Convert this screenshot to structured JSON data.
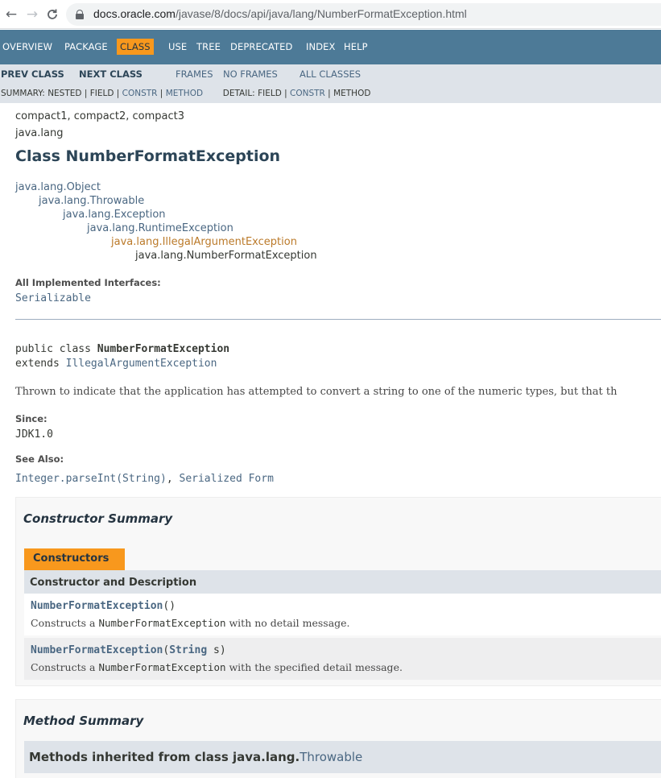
{
  "browser": {
    "back_icon": "←",
    "forward_icon": "→",
    "reload_icon": "C",
    "url_host": "docs.oracle.com",
    "url_path": "/javase/8/docs/api/java/lang/NumberFormatException.html"
  },
  "topnav": {
    "items": [
      "OVERVIEW",
      "PACKAGE",
      "CLASS",
      "USE",
      "TREE",
      "DEPRECATED",
      "INDEX",
      "HELP"
    ],
    "active": "CLASS",
    "active_color": "#f8981d",
    "bar_color": "#4d7a97"
  },
  "subnav": {
    "prev_class": "PREV CLASS",
    "next_class": "NEXT CLASS",
    "frames": "FRAMES",
    "no_frames": "NO FRAMES",
    "all_classes": "ALL CLASSES",
    "summary_label": "SUMMARY:",
    "summary_nested": "NESTED",
    "summary_field": "FIELD",
    "summary_constr": "CONSTR",
    "summary_method": "METHOD",
    "detail_label": "DETAIL:",
    "detail_field": "FIELD",
    "detail_constr": "CONSTR",
    "detail_method": "METHOD"
  },
  "header": {
    "profiles": "compact1, compact2, compact3",
    "package": "java.lang",
    "title": "Class NumberFormatException"
  },
  "inheritance": [
    "java.lang.Object",
    "java.lang.Throwable",
    "java.lang.Exception",
    "java.lang.RuntimeException",
    "java.lang.IllegalArgumentException",
    "java.lang.NumberFormatException"
  ],
  "interfaces": {
    "label": "All Implemented Interfaces:",
    "value": "Serializable"
  },
  "declaration": {
    "line1_prefix": "public class ",
    "line1_name": "NumberFormatException",
    "line2_prefix": "extends ",
    "line2_link": "IllegalArgumentException"
  },
  "description": "Thrown to indicate that the application has attempted to convert a string to one of the numeric types, but that th",
  "since": {
    "label": "Since:",
    "value": "JDK1.0"
  },
  "see_also": {
    "label": "See Also:",
    "link1": "Integer.parseInt(String)",
    "separator": ", ",
    "link2": "Serialized Form"
  },
  "constructor_summary": {
    "title": "Constructor Summary",
    "tab": "Constructors",
    "column": "Constructor and Description",
    "rows": [
      {
        "name": "NumberFormatException",
        "params_open": "(",
        "param_type": "",
        "param_name": "",
        "params_close": ")",
        "desc_prefix": "Constructs a ",
        "desc_code": "NumberFormatException",
        "desc_suffix": " with no detail message."
      },
      {
        "name": "NumberFormatException",
        "params_open": "(",
        "param_type": "String",
        "param_name": " s",
        "params_close": ")",
        "desc_prefix": "Constructs a ",
        "desc_code": "NumberFormatException",
        "desc_suffix": " with the specified detail message."
      }
    ]
  },
  "method_summary": {
    "title": "Method Summary",
    "inherited_prefix": "Methods inherited from class java.lang.",
    "inherited_link": "Throwable"
  }
}
